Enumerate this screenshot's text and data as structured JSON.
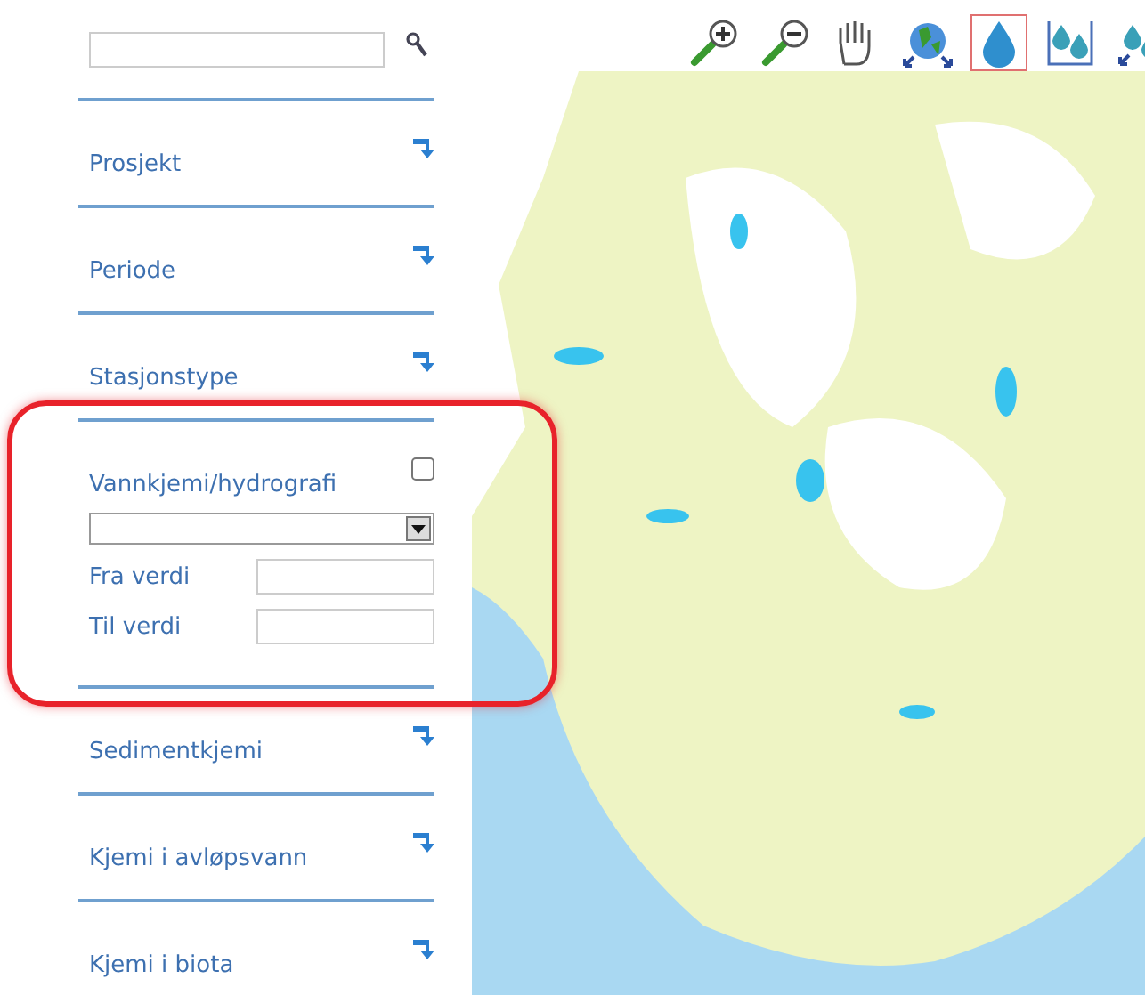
{
  "tools": [
    {
      "kind": "zoom-in",
      "selected": false
    },
    {
      "kind": "zoom-out",
      "selected": false
    },
    {
      "kind": "pan",
      "selected": false
    },
    {
      "kind": "globe",
      "selected": false
    },
    {
      "kind": "drop",
      "selected": true
    },
    {
      "kind": "drops",
      "selected": false
    },
    {
      "kind": "drops-arrows",
      "selected": false
    }
  ],
  "sections": [
    {
      "kind": "collapsed",
      "label": "Prosjekt"
    },
    {
      "kind": "collapsed",
      "label": "Periode"
    },
    {
      "kind": "collapsed",
      "label": "Stasjonstype"
    },
    {
      "kind": "expanded",
      "label": "Vannkjemi/hydrografi",
      "checked": false,
      "highlighted": true,
      "fields": [
        {
          "label": "Fra verdi"
        },
        {
          "label": "Til verdi"
        }
      ]
    },
    {
      "kind": "collapsed",
      "label": "Sedimentkjemi"
    },
    {
      "kind": "collapsed",
      "label": "Kjemi i avløpsvann"
    },
    {
      "kind": "collapsed",
      "label": "Kjemi i biota"
    }
  ]
}
